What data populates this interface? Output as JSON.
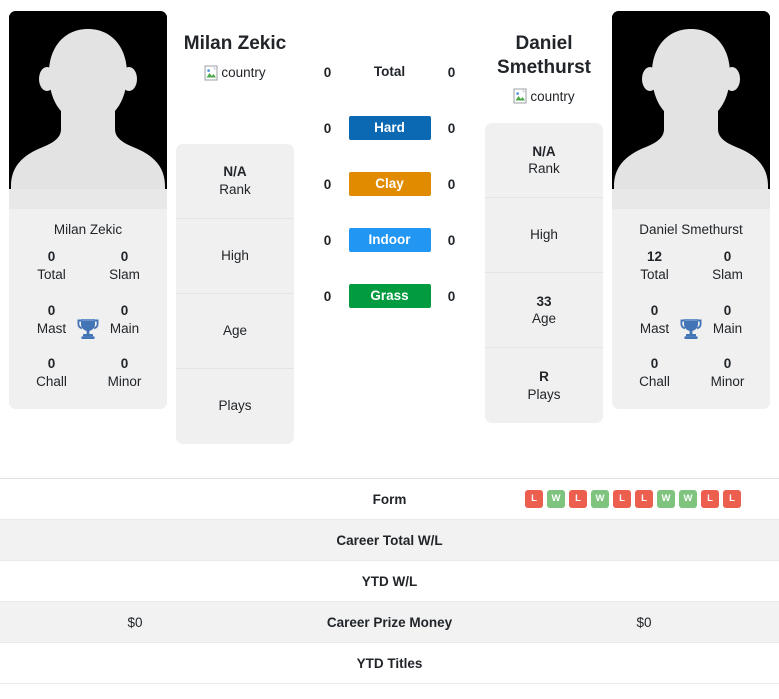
{
  "players": {
    "left": {
      "name": "Milan Zekic",
      "card_name": "Milan Zekic",
      "flag_alt": "country",
      "photo_alt": "player photo",
      "titles": [
        {
          "num": "0",
          "label": "Total"
        },
        {
          "num": "0",
          "label": "Slam"
        },
        {
          "num": "0",
          "label": "Mast"
        },
        {
          "num": "0",
          "label": "Main"
        },
        {
          "num": "0",
          "label": "Chall"
        },
        {
          "num": "0",
          "label": "Minor"
        }
      ],
      "info": [
        {
          "value": "N/A",
          "label": "Rank"
        },
        {
          "value": "",
          "label": "High"
        },
        {
          "value": "",
          "label": "Age"
        },
        {
          "value": "",
          "label": "Plays"
        }
      ]
    },
    "right": {
      "name": "Daniel Smethurst",
      "card_name": "Daniel Smethurst",
      "flag_alt": "country",
      "photo_alt": "player photo",
      "titles": [
        {
          "num": "12",
          "label": "Total"
        },
        {
          "num": "0",
          "label": "Slam"
        },
        {
          "num": "0",
          "label": "Mast"
        },
        {
          "num": "0",
          "label": "Main"
        },
        {
          "num": "0",
          "label": "Chall"
        },
        {
          "num": "0",
          "label": "Minor"
        }
      ],
      "info": [
        {
          "value": "N/A",
          "label": "Rank"
        },
        {
          "value": "",
          "label": "High"
        },
        {
          "value": "33",
          "label": "Age"
        },
        {
          "value": "R",
          "label": "Plays"
        }
      ]
    }
  },
  "surfaces": [
    {
      "label": "Total",
      "left": "0",
      "right": "0",
      "color": "transparent",
      "plain": true
    },
    {
      "label": "Hard",
      "left": "0",
      "right": "0",
      "color": "#0b69b4",
      "plain": false
    },
    {
      "label": "Clay",
      "left": "0",
      "right": "0",
      "color": "#e08b00",
      "plain": false
    },
    {
      "label": "Indoor",
      "left": "0",
      "right": "0",
      "color": "#2196f3",
      "plain": false
    },
    {
      "label": "Grass",
      "left": "0",
      "right": "0",
      "color": "#039b3f",
      "plain": false
    }
  ],
  "stats": [
    {
      "label": "Form",
      "left_text": "",
      "right_text": "",
      "right_form": [
        "L",
        "W",
        "L",
        "W",
        "L",
        "L",
        "W",
        "W",
        "L",
        "L"
      ],
      "left_form": []
    },
    {
      "label": "Career Total W/L",
      "left_text": "",
      "right_text": ""
    },
    {
      "label": "YTD W/L",
      "left_text": "",
      "right_text": ""
    },
    {
      "label": "Career Prize Money",
      "left_text": "$0",
      "right_text": "$0"
    },
    {
      "label": "YTD Titles",
      "left_text": "",
      "right_text": ""
    }
  ],
  "colors": {
    "win_badge": "#7ec47e",
    "loss_badge": "#ec5f4e",
    "trophy": "#4374b5",
    "card_bg": "#f0f0f0",
    "row_alt_bg": "#f2f2f2"
  }
}
